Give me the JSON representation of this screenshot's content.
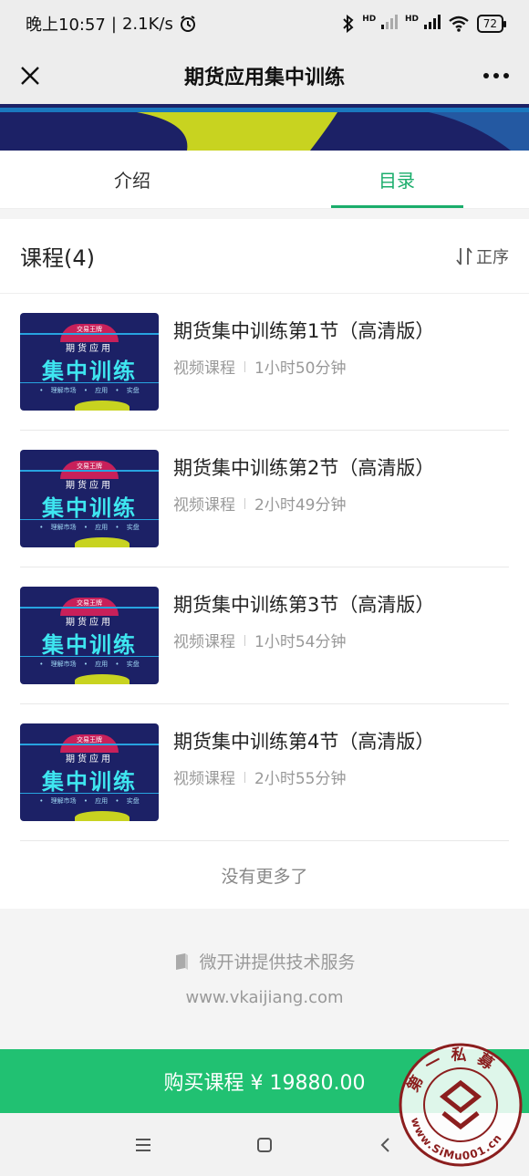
{
  "status": {
    "time": "晚上10:57",
    "net_speed": "2.1K/s",
    "hd1": "HD",
    "hd2": "HD",
    "battery": "72"
  },
  "nav": {
    "title": "期货应用集中训练"
  },
  "tabs": [
    {
      "label": "介绍",
      "active": false
    },
    {
      "label": "目录",
      "active": true
    }
  ],
  "section": {
    "title": "课程(4)",
    "sort_label": "正序"
  },
  "thumb": {
    "arc_text": "交易王牌",
    "sub": "期货应用",
    "big": "集中训练",
    "tags": "• 理解市场  • 应用  • 实盘"
  },
  "courses": [
    {
      "title": "期货集中训练第1节（高清版）",
      "type": "视频课程",
      "duration": "1小时50分钟"
    },
    {
      "title": "期货集中训练第2节（高清版）",
      "type": "视频课程",
      "duration": "2小时49分钟"
    },
    {
      "title": "期货集中训练第3节（高清版）",
      "type": "视频课程",
      "duration": "1小时54分钟"
    },
    {
      "title": "期货集中训练第4节（高清版）",
      "type": "视频课程",
      "duration": "2小时55分钟"
    }
  ],
  "list_end": "没有更多了",
  "footer": {
    "powered": "微开讲提供技术服务",
    "site": "www.vkaijiang.com"
  },
  "buy": {
    "label": "购买课程 ¥ 19880.00"
  },
  "watermark": {
    "top_text": "第一私募",
    "bottom_text": "www.SiMu001.cn"
  },
  "colors": {
    "accent": "#1aad6b",
    "buy_bar": "#21c172",
    "thumb_bg": "#1c2166"
  }
}
